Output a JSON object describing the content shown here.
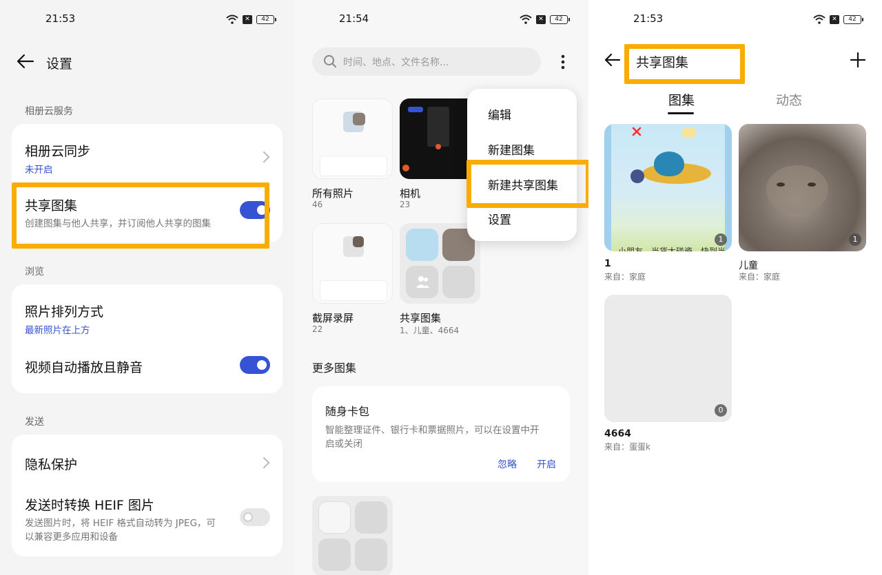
{
  "status_bars": [
    {
      "time": "21:53",
      "battery": "42"
    },
    {
      "time": "21:54",
      "battery": "42"
    },
    {
      "time": "21:53",
      "battery": "42"
    }
  ],
  "settings": {
    "title": "设置",
    "sections": {
      "cloud": "相册云服务",
      "browse": "浏览",
      "send": "发送"
    },
    "cloud_sync": {
      "title": "相册云同步",
      "status": "未开启"
    },
    "shared_album": {
      "title": "共享图集",
      "desc": "创建图集与他人共享，并订阅他人共享的图集",
      "enabled": true
    },
    "sort": {
      "title": "照片排列方式",
      "value": "最新照片在上方"
    },
    "autoplay": {
      "title": "视频自动播放且静音",
      "enabled": true
    },
    "privacy": {
      "title": "隐私保护"
    },
    "heif": {
      "title": "发送时转换 HEIF 图片",
      "desc_line1": "发送图片时，将 HEIF 格式自动转为 JPEG，可",
      "desc_line2": "以兼容更多应用和设备",
      "enabled": false
    }
  },
  "albums": {
    "search_placeholder": "时间、地点、文件名称...",
    "items": [
      {
        "title": "所有照片",
        "count": "46"
      },
      {
        "title": "相机",
        "count": "23"
      },
      {
        "title": "截屏录屏",
        "count": "22"
      },
      {
        "title": "共享图集",
        "count": "1、儿童、4664"
      }
    ],
    "menu": [
      "编辑",
      "新建图集",
      "新建共享图集",
      "设置"
    ],
    "more_title": "更多图集",
    "promo": {
      "title": "随身卡包",
      "desc_line1": "智能整理证件、银行卡和票据照片，可以在设置中开",
      "desc_line2": "启或关闭",
      "ignore": "忽略",
      "enable": "开启"
    }
  },
  "shared": {
    "title": "共享图集",
    "tabs": [
      "图集",
      "动态"
    ],
    "active_tab": 0,
    "cards": [
      {
        "name": "1",
        "from": "来自：家庭",
        "count": "1",
        "caption": "小朋友，当货太碰瓷，快到当"
      },
      {
        "name": "儿童",
        "from": "来自：家庭",
        "count": "1"
      },
      {
        "name": "4664",
        "from": "来自：蛋蛋k",
        "count": "0"
      }
    ]
  },
  "colors": {
    "accent": "#3553d4",
    "highlight": "#f9ad00"
  }
}
